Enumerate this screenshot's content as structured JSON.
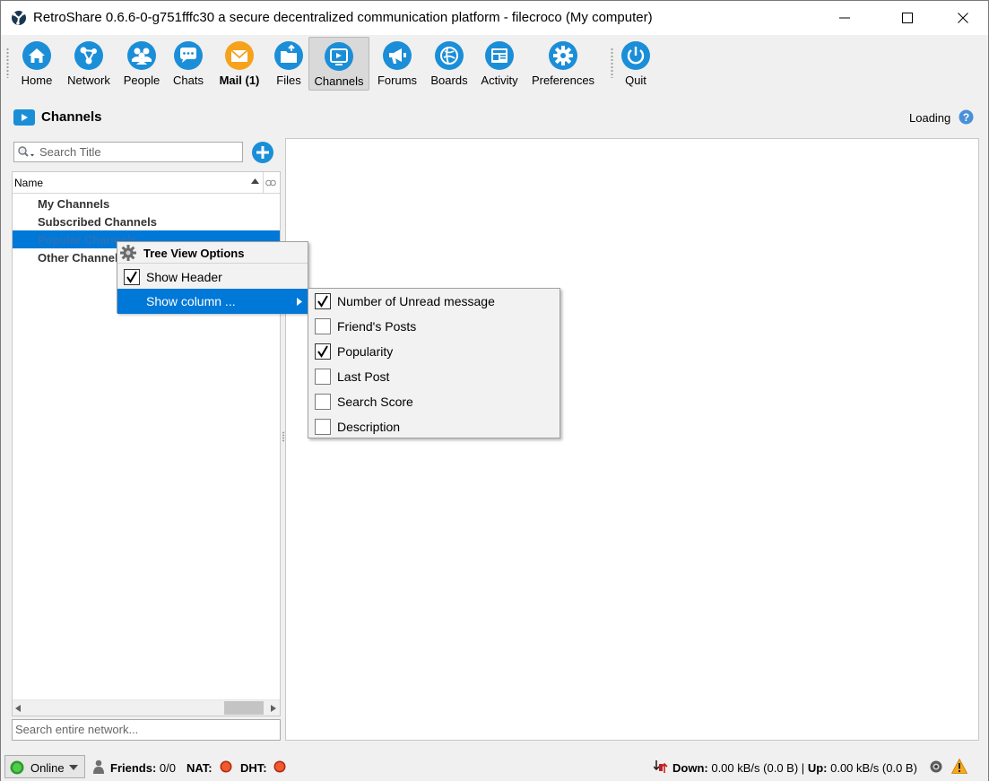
{
  "window": {
    "title": "RetroShare 0.6.6-0-g751fffc30 a secure decentralized communication platform - filecroco (My computer)"
  },
  "toolbar": {
    "items": [
      {
        "label": "Home",
        "icon": "home-icon"
      },
      {
        "label": "Network",
        "icon": "network-icon"
      },
      {
        "label": "People",
        "icon": "people-icon"
      },
      {
        "label": "Chats",
        "icon": "chats-icon"
      },
      {
        "label": "Mail (1)",
        "icon": "mail-icon"
      },
      {
        "label": "Files",
        "icon": "files-icon"
      },
      {
        "label": "Channels",
        "icon": "channels-icon"
      },
      {
        "label": "Forums",
        "icon": "forums-icon"
      },
      {
        "label": "Boards",
        "icon": "boards-icon"
      },
      {
        "label": "Activity",
        "icon": "activity-icon"
      },
      {
        "label": "Preferences",
        "icon": "preferences-icon"
      },
      {
        "label": "Quit",
        "icon": "quit-icon"
      }
    ],
    "active": "Channels"
  },
  "page": {
    "title": "Channels",
    "status": "Loading"
  },
  "left_panel": {
    "search_placeholder": "Search Title",
    "tree_header": "Name",
    "tree_items": [
      "My Channels",
      "Subscribed Channels",
      "Popular Channels",
      "Other Channels"
    ],
    "selected_item": "Popular Channels",
    "network_search_placeholder": "Search entire network..."
  },
  "context_menu": {
    "title": "Tree View Options",
    "items": [
      {
        "label": "Show Header",
        "checked": true
      },
      {
        "label": "Show column ...",
        "submenu": true
      }
    ]
  },
  "column_submenu": {
    "items": [
      {
        "label": "Number of Unread message",
        "checked": true
      },
      {
        "label": "Friend's Posts",
        "checked": false
      },
      {
        "label": "Popularity",
        "checked": true
      },
      {
        "label": "Last Post",
        "checked": false
      },
      {
        "label": "Search Score",
        "checked": false
      },
      {
        "label": "Description",
        "checked": false
      }
    ]
  },
  "statusbar": {
    "online": "Online",
    "friends_label": "Friends:",
    "friends_value": "0/0",
    "nat_label": "NAT:",
    "dht_label": "DHT:",
    "down_label": "Down:",
    "down_value": "0.00 kB/s (0.0 B)",
    "separator": "|",
    "up_label": "Up:",
    "up_value": "0.00 kB/s (0.0 B)"
  },
  "colors": {
    "toolbar_icon_blue": "#1b8ed8",
    "mail_orange": "#f6a21c",
    "selection": "#0078d7",
    "status_red": "#e8391d",
    "status_green": "#3db83a"
  }
}
